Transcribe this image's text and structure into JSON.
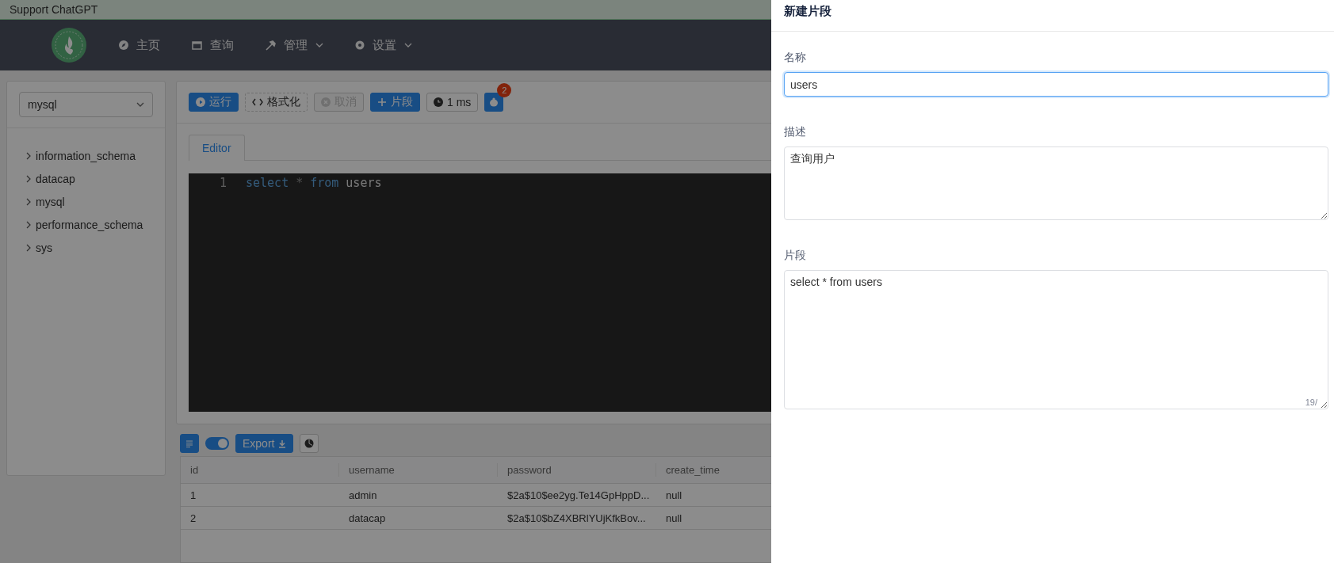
{
  "banner": {
    "text": "Support ChatGPT"
  },
  "nav": {
    "items": [
      {
        "label": "主页",
        "has_menu": false
      },
      {
        "label": "查询",
        "has_menu": false
      },
      {
        "label": "管理",
        "has_menu": true
      },
      {
        "label": "设置",
        "has_menu": true
      }
    ]
  },
  "sidebar": {
    "source": "mysql",
    "tree": [
      {
        "label": "information_schema",
        "expanded": false
      },
      {
        "label": "datacap",
        "expanded": false
      },
      {
        "label": "mysql",
        "expanded": false
      },
      {
        "label": "performance_schema",
        "expanded": false
      },
      {
        "label": "sys",
        "expanded": false
      }
    ]
  },
  "toolbar": {
    "buttons": [
      {
        "label": "运行",
        "kind": "primary",
        "disabled": false
      },
      {
        "label": "格式化",
        "kind": "dashed",
        "disabled": false
      },
      {
        "label": "取消",
        "kind": "default",
        "disabled": true
      },
      {
        "label": "片段",
        "kind": "primary",
        "disabled": false
      },
      {
        "label": "1 ms",
        "kind": "default",
        "disabled": false
      }
    ],
    "badge": "2"
  },
  "editor": {
    "tabs": [
      {
        "label": "Editor",
        "selected": true
      }
    ],
    "lines": [
      {
        "number": "1",
        "tokens": [
          {
            "text": "select",
            "kind": "keyword"
          },
          {
            "text": "*",
            "kind": "operator"
          },
          {
            "text": "from",
            "kind": "keyword"
          },
          {
            "text": "users",
            "kind": "identifier"
          }
        ]
      }
    ]
  },
  "results": {
    "toggle_on": true,
    "export": "Export",
    "columns": [
      "id",
      "username",
      "password",
      "create_time"
    ],
    "rows": [
      [
        "1",
        "admin",
        "$2a$10$ee2yg.Te14GpHppD...",
        "null"
      ],
      [
        "2",
        "datacap",
        "$2a$10$bZ4XBRlYUjKfkBov...",
        "null"
      ]
    ]
  },
  "drawer": {
    "title": "新建片段",
    "fields": [
      {
        "label": "名称",
        "kind": "input",
        "value": "users",
        "focused": true
      },
      {
        "label": "描述",
        "kind": "textarea",
        "value": "查询用户",
        "focused": false
      },
      {
        "label": "片段",
        "kind": "code",
        "value": "select * from users",
        "focused": false,
        "counter": "19/"
      }
    ]
  }
}
